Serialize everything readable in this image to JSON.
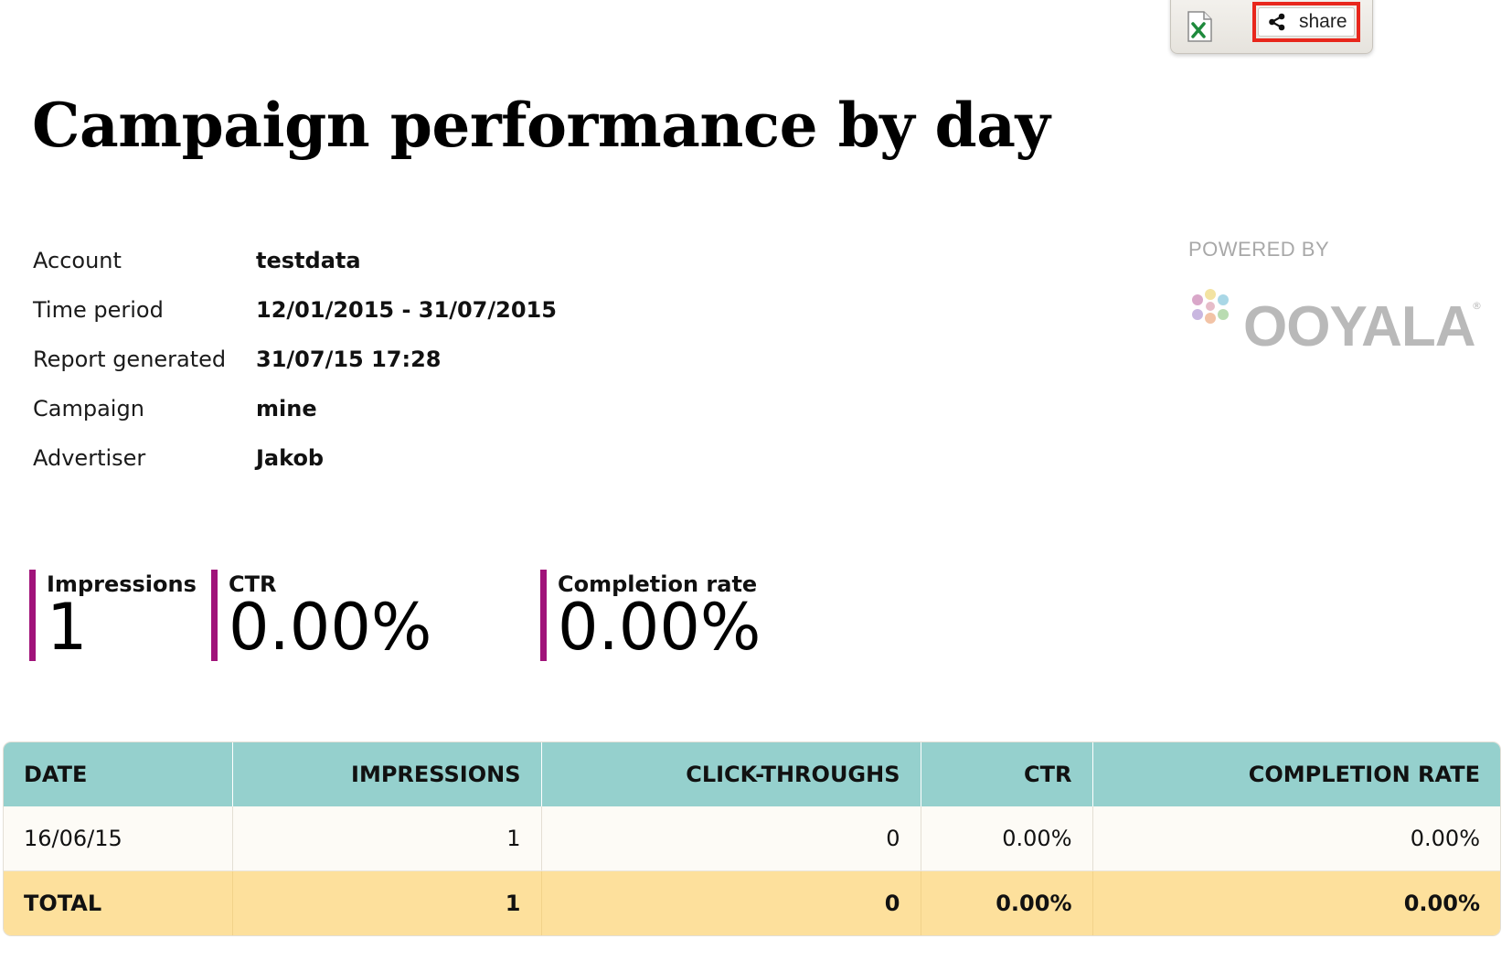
{
  "toolbar": {
    "excel_icon": "excel-icon",
    "share_icon": "share-icon",
    "share_label": "share",
    "highlight_color": "#e8271c"
  },
  "title": "Campaign performance by day",
  "meta": [
    {
      "label": "Account",
      "value": "testdata"
    },
    {
      "label": "Time period",
      "value": "12/01/2015 - 31/07/2015"
    },
    {
      "label": "Report generated",
      "value": "31/07/15 17:28"
    },
    {
      "label": "Campaign",
      "value": "mine"
    },
    {
      "label": "Advertiser",
      "value": "Jakob"
    }
  ],
  "powered_by": {
    "label": "POWERED BY",
    "brand": "OOYALA",
    "registered_mark": "®"
  },
  "kpis": [
    {
      "label": "Impressions",
      "value": "1"
    },
    {
      "label": "CTR",
      "value": "0.00%"
    },
    {
      "label": "Completion rate",
      "value": "0.00%"
    }
  ],
  "colors": {
    "kpi_accent": "#a0137a",
    "table_header": "#95d0cd",
    "total_row": "#fde09c"
  },
  "table": {
    "columns": [
      "DATE",
      "IMPRESSIONS",
      "CLICK-THROUGHS",
      "CTR",
      "COMPLETION RATE"
    ],
    "rows": [
      [
        "16/06/15",
        "1",
        "0",
        "0.00%",
        "0.00%"
      ]
    ],
    "total": [
      "TOTAL",
      "1",
      "0",
      "0.00%",
      "0.00%"
    ]
  }
}
